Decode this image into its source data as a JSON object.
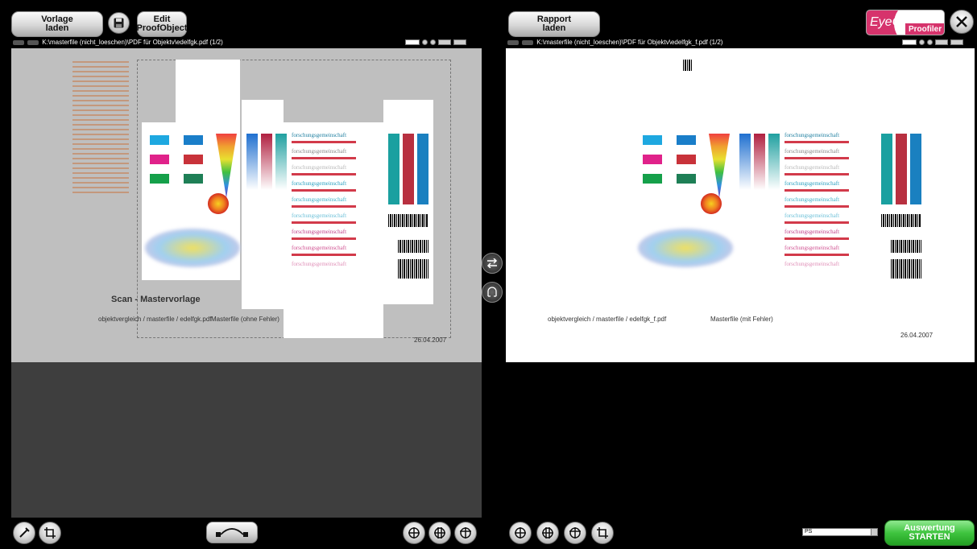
{
  "left": {
    "load_template_button": "Vorlage\nladen",
    "edit_proof_button": "Edit\nProofObject",
    "path": "K:\\masterfile (nicht_loeschen)\\PDF für Objektv\\edelfgk.pdf (1/2)",
    "doc": {
      "scan_title": "Scan - Mastervorlage",
      "file_label": "objektvergleich / masterfile / edelfgk.pdf",
      "file_status": "Masterfile (ohne Fehler)",
      "date": "26.04.2007",
      "brand_text": "forschungsgemeinschaft"
    }
  },
  "right": {
    "load_report_button": "Rapport\nladen",
    "path": "K:\\masterfile (nicht_loeschen)\\PDF für Objektv\\edelfgk_f.pdf (1/2)",
    "logo_eye": "EyeC",
    "logo_product": "Proofiler",
    "doc": {
      "file_label": "objektvergleich / masterfile / edelfgk_f.pdf",
      "file_status": "Masterfile (mit Fehler)",
      "date": "26.04.2007",
      "brand_text": "forschungsgemeinschaft"
    }
  },
  "bottom": {
    "dropdown_value": "PS",
    "start_button": "Auswertung\nSTARTEN"
  },
  "colors": {
    "accent_green": "#3fc43f",
    "logo_pink": "#d6336c",
    "panel_gray": "#bfbfbf",
    "panel_dark": "#3e3e3e"
  }
}
